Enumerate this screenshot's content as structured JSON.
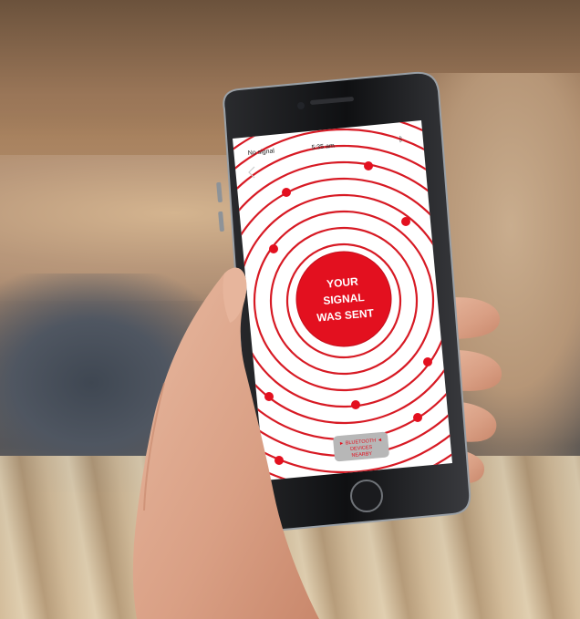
{
  "phone": {
    "status_bar": {
      "carrier": "No signal",
      "time": "5:35 am",
      "bluetooth_icon": "bluetooth-icon"
    },
    "app": {
      "back_icon": "chevron-left-icon",
      "center_message_lines": [
        "YOUR",
        "SIGNAL",
        "WAS SENT"
      ],
      "bottom_badge_lines": [
        "► BLUETOOTH ◄",
        "DEVICES",
        "NEARBY"
      ],
      "accent_color": "#e3101f",
      "ring_color": "#d71a24"
    }
  }
}
